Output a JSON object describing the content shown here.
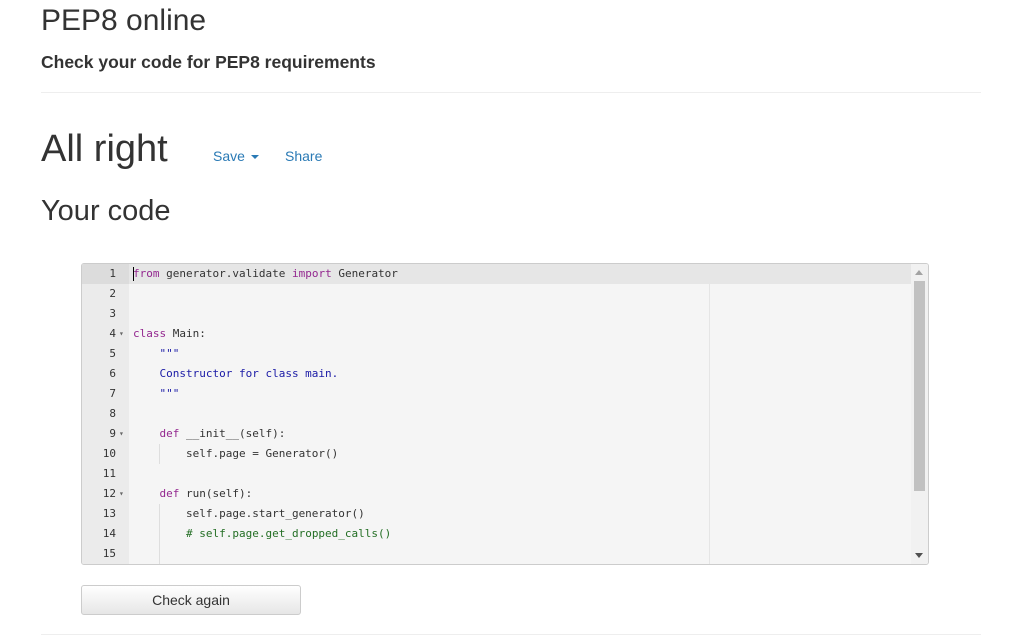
{
  "header": {
    "title": "PEP8 online",
    "subtitle": "Check your code for PEP8 requirements"
  },
  "result": {
    "title": "All right",
    "save_label": "Save",
    "share_label": "Share"
  },
  "code_section": {
    "title": "Your code"
  },
  "editor": {
    "lines": [
      {
        "n": "1",
        "fold": false,
        "tokens": [
          {
            "t": "from",
            "c": "kw"
          },
          {
            "t": " generator.validate ",
            "c": ""
          },
          {
            "t": "import",
            "c": "kw"
          },
          {
            "t": " Generator",
            "c": ""
          }
        ]
      },
      {
        "n": "2",
        "fold": false,
        "tokens": []
      },
      {
        "n": "3",
        "fold": false,
        "tokens": []
      },
      {
        "n": "4",
        "fold": true,
        "tokens": [
          {
            "t": "class",
            "c": "kw"
          },
          {
            "t": " Main:",
            "c": ""
          }
        ]
      },
      {
        "n": "5",
        "fold": false,
        "tokens": [
          {
            "t": "    \"\"\"",
            "c": "str"
          }
        ]
      },
      {
        "n": "6",
        "fold": false,
        "tokens": [
          {
            "t": "    Constructor for class main.",
            "c": "str"
          }
        ]
      },
      {
        "n": "7",
        "fold": false,
        "tokens": [
          {
            "t": "    \"\"\"",
            "c": "str"
          }
        ]
      },
      {
        "n": "8",
        "fold": false,
        "tokens": []
      },
      {
        "n": "9",
        "fold": true,
        "tokens": [
          {
            "t": "    ",
            "c": ""
          },
          {
            "t": "def",
            "c": "kw"
          },
          {
            "t": " __init__(self):",
            "c": ""
          }
        ]
      },
      {
        "n": "10",
        "fold": false,
        "tokens": [
          {
            "t": "        self.page = Generator()",
            "c": ""
          }
        ]
      },
      {
        "n": "11",
        "fold": false,
        "tokens": []
      },
      {
        "n": "12",
        "fold": true,
        "tokens": [
          {
            "t": "    ",
            "c": ""
          },
          {
            "t": "def",
            "c": "kw"
          },
          {
            "t": " run(self):",
            "c": ""
          }
        ]
      },
      {
        "n": "13",
        "fold": false,
        "tokens": [
          {
            "t": "        self.page.start_generator()",
            "c": ""
          }
        ]
      },
      {
        "n": "14",
        "fold": false,
        "tokens": [
          {
            "t": "        ",
            "c": ""
          },
          {
            "t": "# self.page.get_dropped_calls()",
            "c": "cmt"
          }
        ]
      },
      {
        "n": "15",
        "fold": false,
        "tokens": []
      }
    ]
  },
  "actions": {
    "check_again_label": "Check again"
  }
}
